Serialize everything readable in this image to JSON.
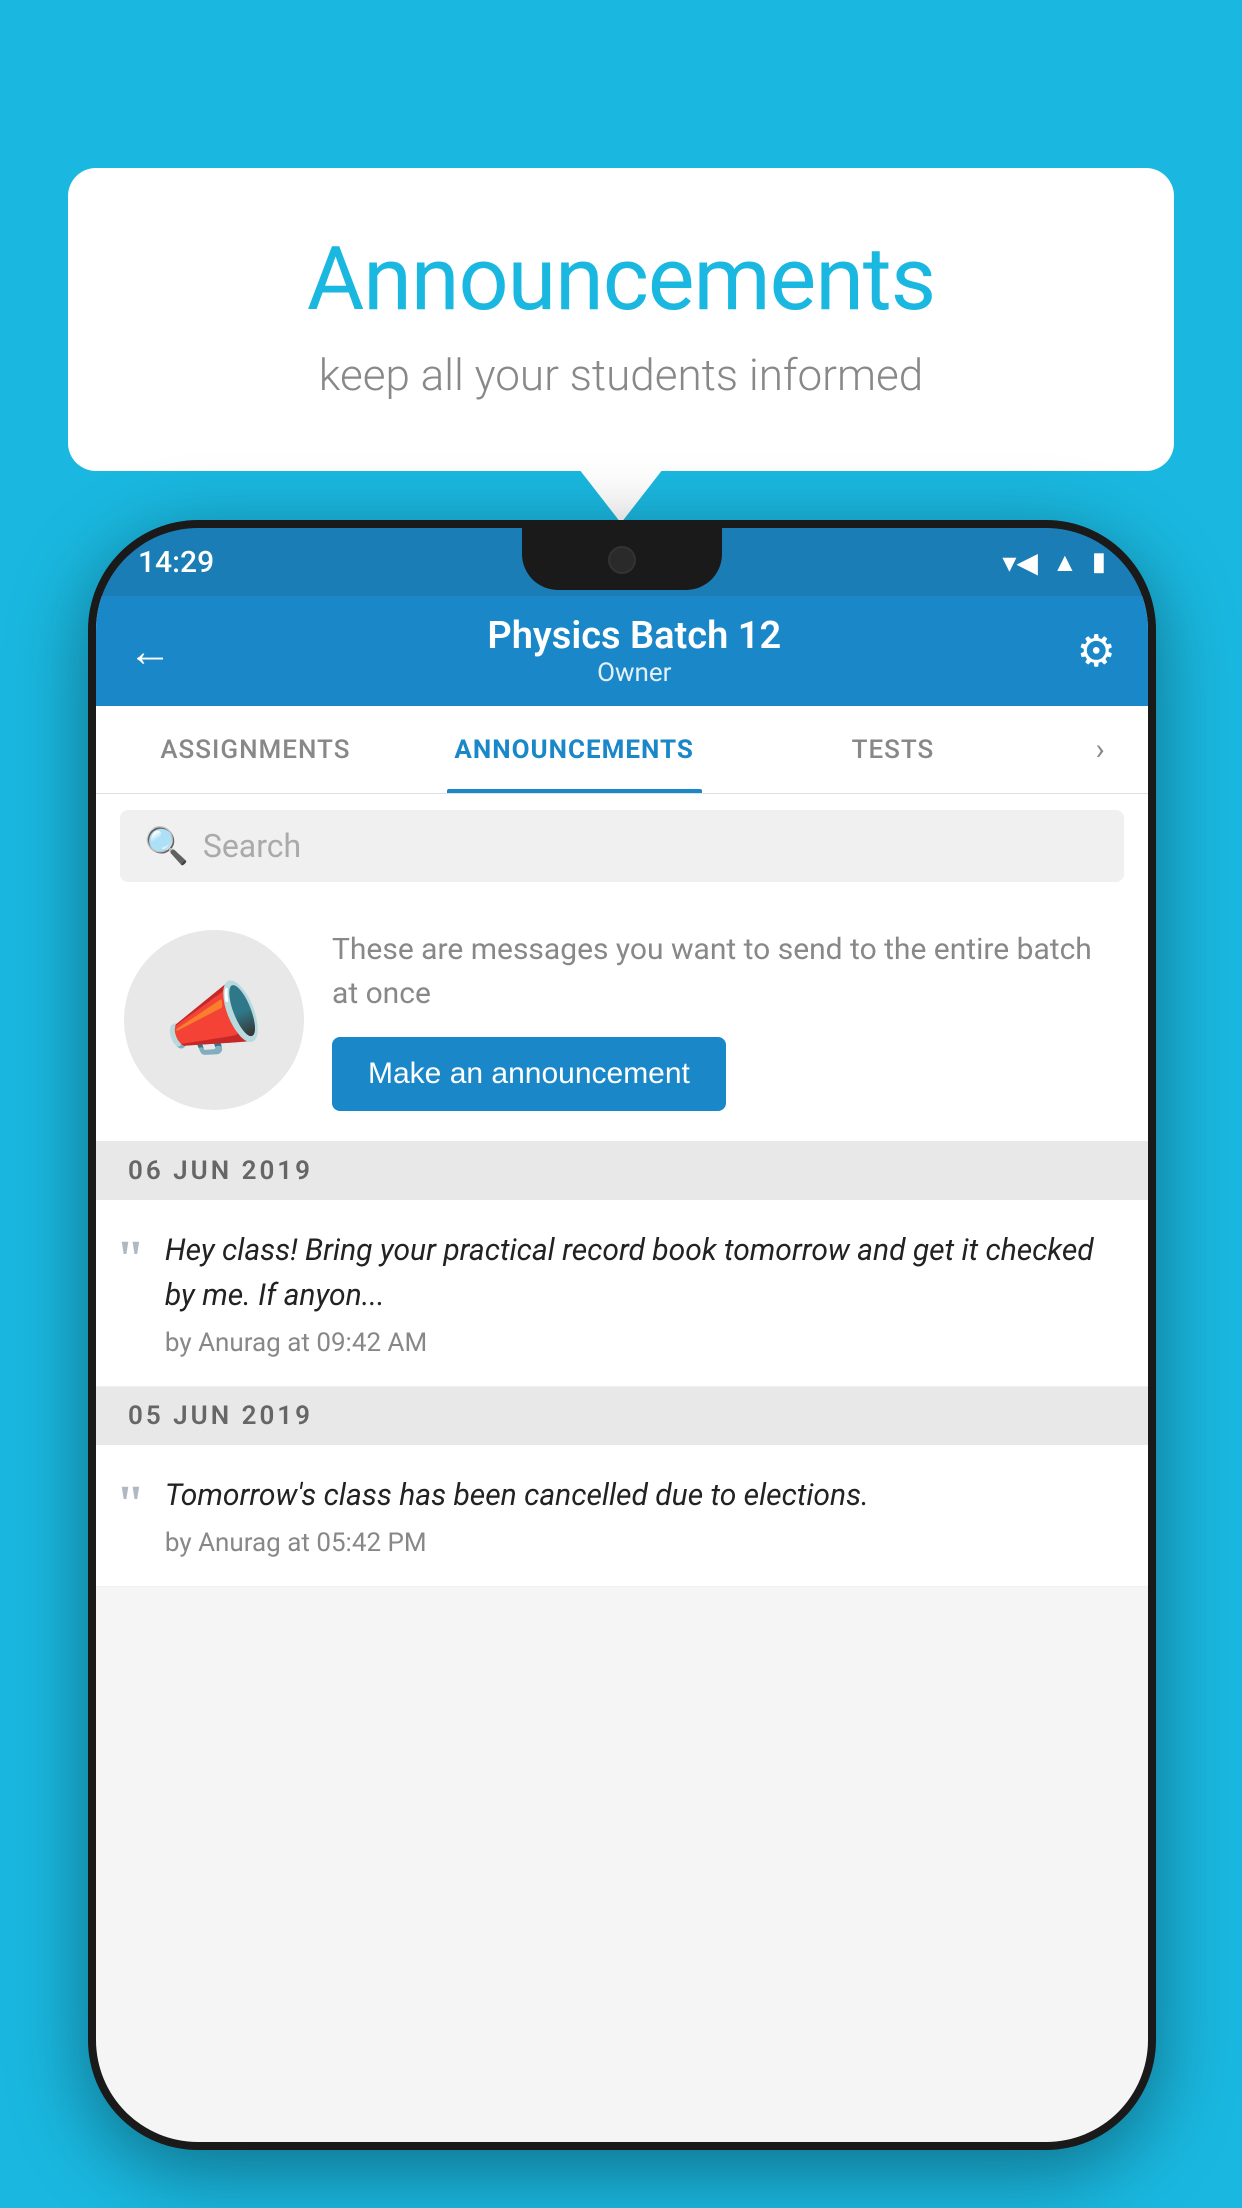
{
  "page": {
    "background_color": "#1ab8e0"
  },
  "speech_bubble": {
    "title": "Announcements",
    "subtitle": "keep all your students informed"
  },
  "phone": {
    "status_bar": {
      "time": "14:29",
      "wifi_icon": "wifi",
      "signal_icon": "signal",
      "battery_icon": "battery"
    },
    "header": {
      "back_label": "←",
      "title": "Physics Batch 12",
      "subtitle": "Owner",
      "settings_icon": "gear"
    },
    "tabs": [
      {
        "label": "ASSIGNMENTS",
        "active": false
      },
      {
        "label": "ANNOUNCEMENTS",
        "active": true
      },
      {
        "label": "TESTS",
        "active": false
      }
    ],
    "search": {
      "placeholder": "Search"
    },
    "promo": {
      "text": "These are messages you want to send to the entire batch at once",
      "button_label": "Make an announcement"
    },
    "date_sections": [
      {
        "date": "06  JUN  2019",
        "announcements": [
          {
            "text": "Hey class! Bring your practical record book tomorrow and get it checked by me. If anyon...",
            "meta": "by Anurag at 09:42 AM"
          }
        ]
      },
      {
        "date": "05  JUN  2019",
        "announcements": [
          {
            "text": "Tomorrow's class has been cancelled due to elections.",
            "meta": "by Anurag at 05:42 PM"
          }
        ]
      }
    ]
  }
}
